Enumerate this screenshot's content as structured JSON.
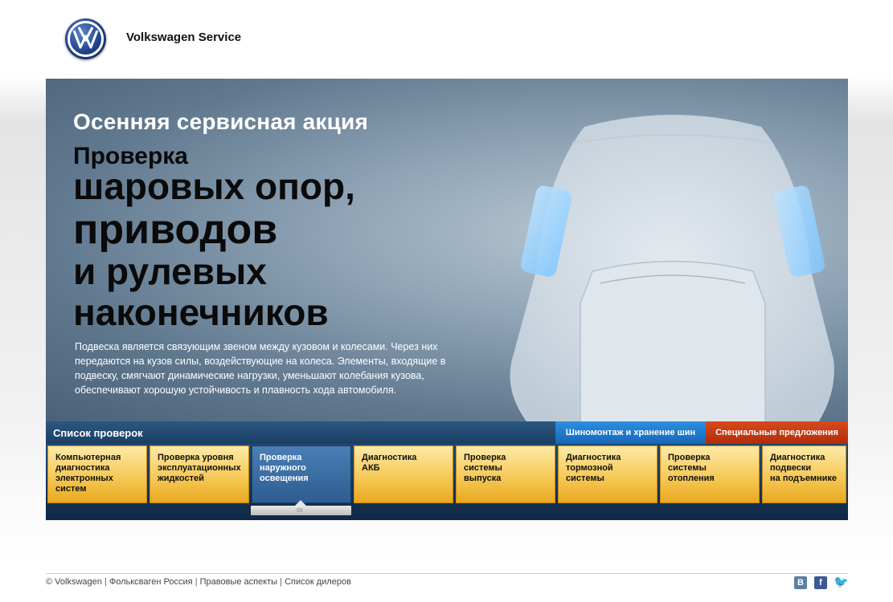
{
  "header": {
    "brand": "Volkswagen Service",
    "logo_icon": "vw-logo-icon"
  },
  "hero": {
    "subtitle": "Осенняя сервисная акция",
    "line1": "Проверка",
    "line2": "шаровых опор,",
    "line3": "приводов",
    "line4": "и рулевых",
    "line5": "наконечников",
    "description": "Подвеска является связующим звеном между кузовом и колесами. Через них передаются на кузов силы, воздействующие на колеса. Элементы, входящие в подвеску, смягчают динамические нагрузки, уменьшают колебания кузова, обеспечивают хорошую устойчивость и плавность хода автомобиля."
  },
  "checks_bar": {
    "title": "Список проверок",
    "tires_button": "Шиномонтаж и хранение шин",
    "offers_button": "Специальные предложения",
    "colors": {
      "tires": "#1f7ed0",
      "offers": "#c43a10",
      "bar": "#23486e"
    }
  },
  "tiles": [
    {
      "label": "Компьютерная\nдиагностика\nэлектронных\nсистем",
      "active": false
    },
    {
      "label": "Проверка уровня\nэксплуатационных\nжидкостей",
      "active": false
    },
    {
      "label": "Проверка\nнаружного\nосвещения",
      "active": true
    },
    {
      "label": "Диагностика\nАКБ",
      "active": false
    },
    {
      "label": "Проверка\nсистемы\nвыпуска",
      "active": false
    },
    {
      "label": "Диагностика\nтормозной\nсистемы",
      "active": false
    },
    {
      "label": "Проверка\nсистемы\nотопления",
      "active": false
    },
    {
      "label": "Диагностика\nподвески\nна подъемнике",
      "active": false
    }
  ],
  "scroll_grip": "IIII",
  "footer": {
    "copyright": "© Volkswagen",
    "links": [
      "Фольксваген Россия",
      "Правовые аспекты",
      "Список дилеров"
    ],
    "separator": "|",
    "social": {
      "vk": "В",
      "facebook": "f",
      "twitter": "🐦"
    }
  }
}
